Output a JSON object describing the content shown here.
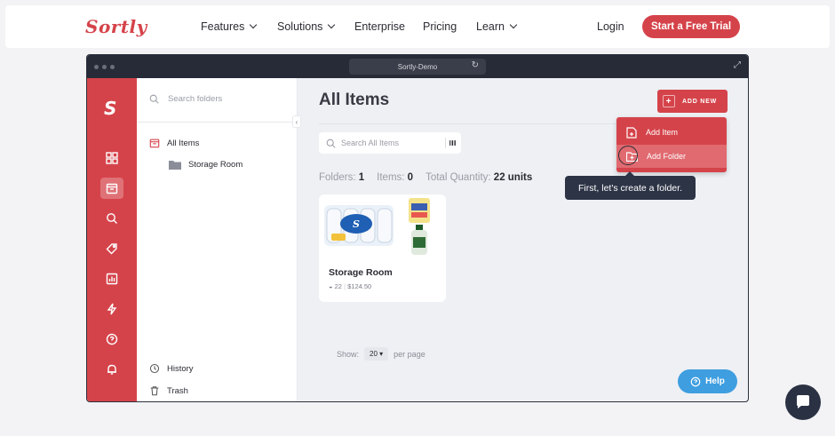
{
  "nav": {
    "logo": "Sortly",
    "links": [
      "Features",
      "Solutions",
      "Enterprise",
      "Pricing",
      "Learn"
    ],
    "login": "Login",
    "cta": "Start a Free Trial"
  },
  "browser": {
    "url_title": "Sortly-Demo"
  },
  "rail": {
    "logo": "S",
    "icons": [
      "dashboard-icon",
      "items-icon",
      "search-icon",
      "tags-icon",
      "reports-icon",
      "workflows-icon",
      "help-circle-icon",
      "bell-icon"
    ]
  },
  "folders_panel": {
    "search_placeholder": "Search folders",
    "all_items": "All Items",
    "subfolder": "Storage Room",
    "history": "History",
    "trash": "Trash"
  },
  "main": {
    "title": "All Items",
    "add_new": "ADD NEW",
    "search_placeholder": "Search All Items",
    "stats": {
      "folders_label": "Folders:",
      "folders_value": "1",
      "items_label": "Items:",
      "items_value": "0",
      "qty_label": "Total Quantity:",
      "qty_value": "22 units"
    },
    "card": {
      "name": "Storage Room",
      "qty": "22",
      "value": "$124.50"
    },
    "pagination": {
      "show_label": "Show:",
      "per_page_value": "20",
      "per_page_label": "per page"
    },
    "help": "Help"
  },
  "dropdown": {
    "items": [
      "Add Item",
      "Add Folder"
    ]
  },
  "tooltip": "First, let's create a folder.",
  "colors": {
    "brand": "#d5434a",
    "dark": "#2d3446",
    "help": "#3e9ee0"
  }
}
